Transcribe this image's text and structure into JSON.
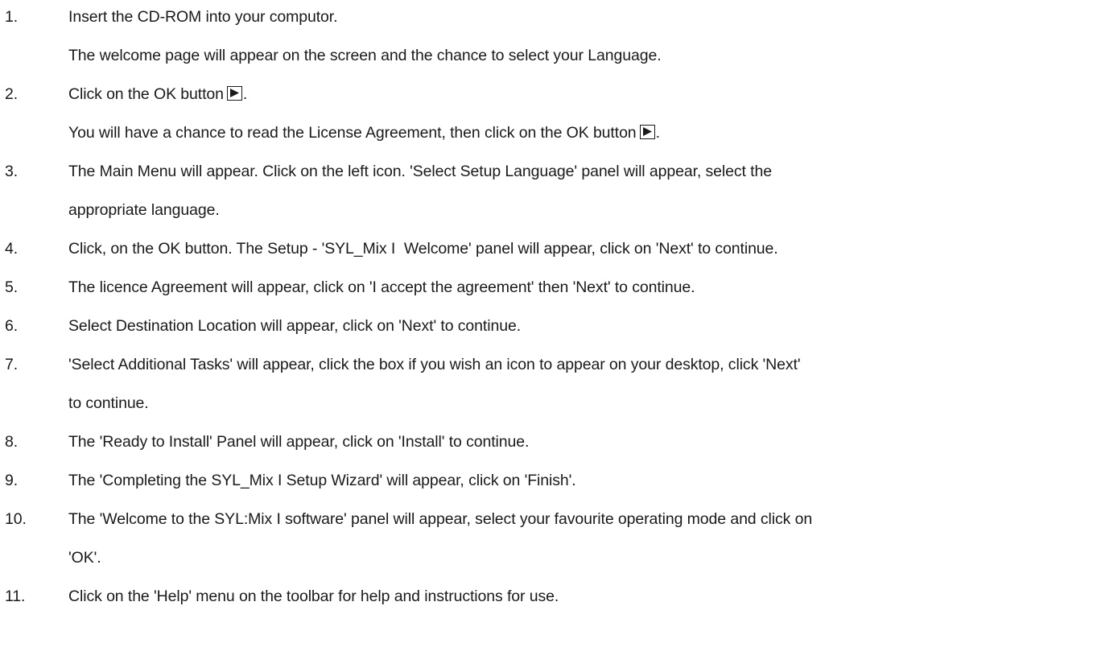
{
  "steps": [
    {
      "number": "1.",
      "lines": [
        "Insert the CD-ROM into your computor.",
        "The welcome page will appear on the screen and the chance to select your Language."
      ]
    },
    {
      "number": "2.",
      "lines": [
        "Click on the OK button",
        "You will have a chance to read the License Agreement, then click on the OK button"
      ],
      "button_icon": "play-button-icon",
      "trailing": "."
    },
    {
      "number": "3.",
      "lines": [
        "The Main Menu will appear. Click on the left icon. 'Select Setup Language' panel will appear, select the",
        "appropriate language."
      ]
    },
    {
      "number": "4.",
      "lines": [
        "Click, on the OK button. The Setup - 'SYL_Mix I  Welcome' panel will appear, click on 'Next' to continue."
      ]
    },
    {
      "number": "5.",
      "lines": [
        "The licence Agreement will appear, click on 'I accept the agreement' then 'Next' to continue."
      ]
    },
    {
      "number": "6.",
      "lines": [
        "Select Destination Location will appear, click on 'Next' to continue."
      ]
    },
    {
      "number": "7.",
      "lines": [
        "'Select Additional Tasks' will appear, click the box if you wish an icon to appear on your desktop, click 'Next'",
        "to continue."
      ]
    },
    {
      "number": "8.",
      "lines": [
        "The 'Ready to Install' Panel will appear, click on 'Install' to continue."
      ]
    },
    {
      "number": "9.",
      "lines": [
        "The 'Completing the SYL_Mix I Setup Wizard' will appear, click on 'Finish'."
      ]
    },
    {
      "number": "10.",
      "lines": [
        "The 'Welcome to the SYL:Mix I software' panel will appear, select your favourite operating mode and click on",
        "'OK'."
      ]
    },
    {
      "number": "11.",
      "lines": [
        "Click on the 'Help' menu on the toolbar for help and instructions for use."
      ]
    }
  ]
}
